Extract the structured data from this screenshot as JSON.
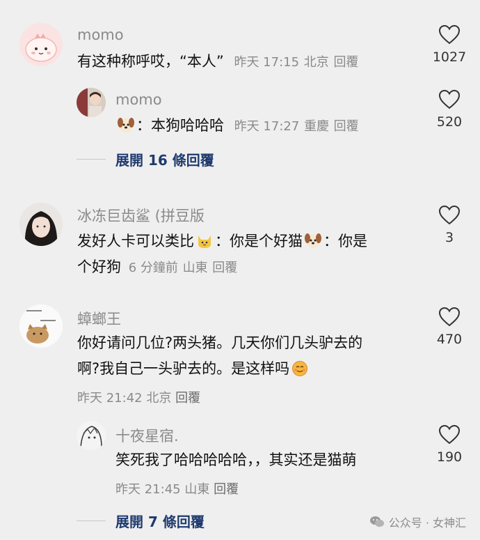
{
  "comments": [
    {
      "username": "momo",
      "text": "有这种称呼哎，“本人”",
      "time": "昨天 17:15",
      "location": "北京",
      "reply_label": "回覆",
      "likes": "1027",
      "avatar_icon": "pink-cartoon-avatar"
    },
    {
      "username": "momo",
      "text_prefix": "：本狗哈哈哈",
      "emoji_icon": "dog-emoji",
      "time": "昨天 17:27",
      "location": "重慶",
      "reply_label": "回覆",
      "likes": "520",
      "avatar_icon": "photo-avatar"
    },
    {
      "username": "冰冻巨齿鲨 (拼豆版",
      "text_part1": "发好人卡可以类比",
      "text_part2": "：你是个好猫",
      "text_part3": "：你是",
      "text_line2": "个好狗",
      "emoji1_icon": "cat-emoji",
      "emoji2_icon": "dog-emoji",
      "time": "6 分鐘前",
      "location": "山東",
      "reply_label": "回覆",
      "likes": "3",
      "avatar_icon": "girl-photo-avatar"
    },
    {
      "username": "蟑螂王",
      "text_line1": "你好请问几位?两头猪。几天你们几头驴去的",
      "text_line2": "啊?我自己一头驴去的。是这样吗",
      "emoji_icon": "smirk-emoji",
      "time": "昨天 21:42",
      "location": "北京",
      "reply_label": "回覆",
      "likes": "470",
      "avatar_icon": "cat-meme-avatar"
    },
    {
      "username": "十夜星宿.",
      "text": "笑死我了哈哈哈哈哈，，其实还是猫萌",
      "time": "昨天 21:45",
      "location": "山東",
      "reply_label": "回覆",
      "likes": "190",
      "avatar_icon": "sketch-avatar"
    }
  ],
  "expand_1": "展開 16 條回覆",
  "expand_2": "展開 7 條回覆",
  "watermark": "公众号 · 女神汇",
  "colors": {
    "background": "#efefef",
    "link": "#1e3a6e",
    "meta": "#8a8a8a"
  }
}
